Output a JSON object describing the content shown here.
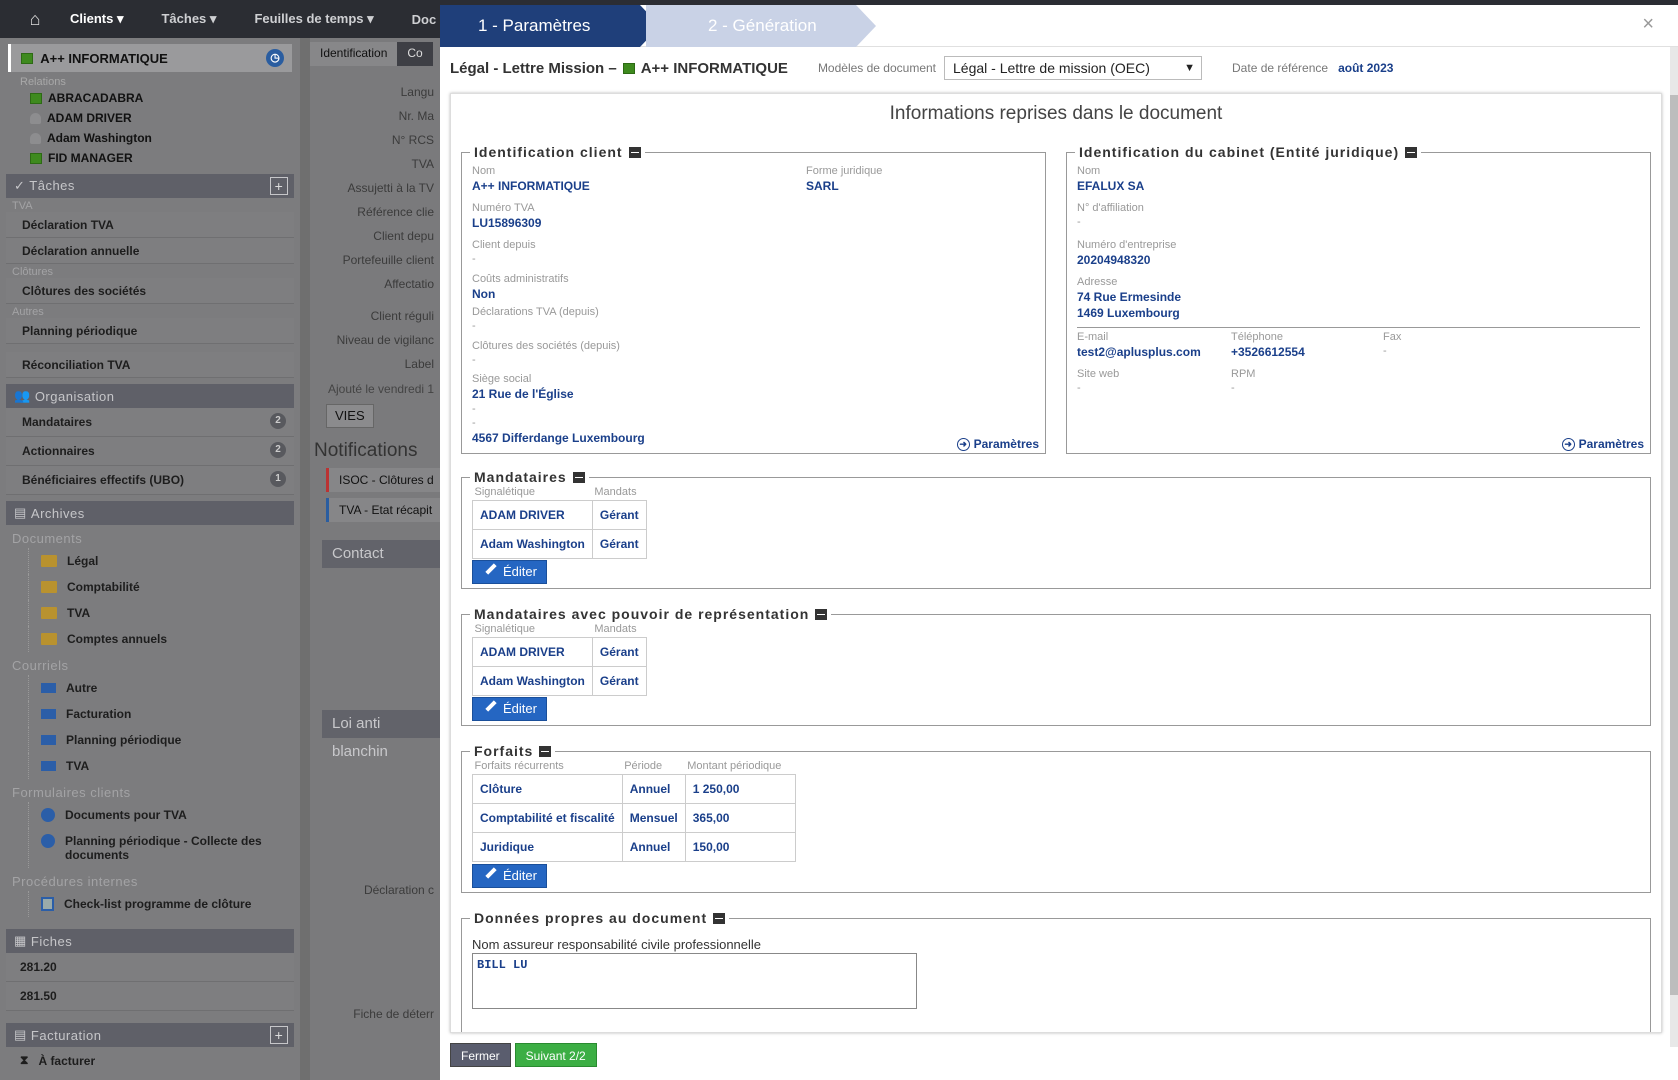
{
  "topnav": {
    "menus": [
      "Clients ▾",
      "Tâches ▾",
      "Feuilles de temps ▾",
      "Doc"
    ]
  },
  "sidebar": {
    "selected_client": "A++ INFORMATIQUE",
    "relations_label": "Relations",
    "relations": [
      "ABRACADABRA",
      "ADAM DRIVER",
      "Adam Washington",
      "FID MANAGER"
    ],
    "taches_head": "✓ Tâches",
    "tva_cat": "TVA",
    "tva_items": [
      "Déclaration TVA",
      "Déclaration annuelle"
    ],
    "clot_cat": "Clôtures",
    "clot_items": [
      "Clôtures des sociétés"
    ],
    "autres_cat": "Autres",
    "autres_items": [
      "Planning périodique"
    ],
    "recon": "Réconciliation TVA",
    "org_head": "Organisation",
    "org_items": [
      {
        "label": "Mandataires",
        "count": "2"
      },
      {
        "label": "Actionnaires",
        "count": "2"
      },
      {
        "label": "Bénéficiaires effectifs (UBO)",
        "count": "1"
      }
    ],
    "archives_head": "Archives",
    "documents_group": "Documents",
    "documents": [
      "Légal",
      "Comptabilité",
      "TVA",
      "Comptes annuels"
    ],
    "courriels_group": "Courriels",
    "courriels": [
      "Autre",
      "Facturation",
      "Planning périodique",
      "TVA"
    ],
    "formulaires_group": "Formulaires clients",
    "formulaires": [
      "Documents pour TVA",
      "Planning périodique - Collecte des documents"
    ],
    "procedures_group": "Procédures internes",
    "procedures": [
      "Check-list programme de clôture"
    ],
    "fiches_head": "Fiches",
    "fiches": [
      "281.20",
      "281.50"
    ],
    "facturation_head": "Facturation",
    "facturation_items": [
      "À facturer"
    ]
  },
  "mid": {
    "tabs": [
      "Identification",
      "Co"
    ],
    "labels": [
      "Langu",
      "Nr. Ma",
      "N° RCS",
      "TVA",
      "Assujetti à la TV",
      "Référence clie",
      "Client depu",
      "Portefeuille client",
      "Affectatio",
      "Client réguli",
      "Niveau de vigilanc",
      "Label"
    ],
    "added": "Ajouté le vendredi 1",
    "vies": "VIES",
    "notifications": "Notifications",
    "notif1": "ISOC - Clôtures d",
    "notif2": "TVA - Etat récapit",
    "contact": "Contact",
    "loi": "Loi anti blanchin",
    "decl": "Déclaration c",
    "fiche": "Fiche de déterr"
  },
  "wizard": {
    "step1": "1 - Paramètres",
    "step2": "2 - Génération",
    "close": "×"
  },
  "header": {
    "title": "Légal - Lettre Mission –",
    "client": "A++ INFORMATIQUE",
    "model_label": "Modèles de document",
    "model_value": "Légal - Lettre de mission (OEC)",
    "date_label": "Date de référence",
    "date_value": "août 2023"
  },
  "content": {
    "title": "Informations reprises dans le document",
    "client": {
      "legend": "Identification client",
      "nom_label": "Nom",
      "nom": "A++ INFORMATIQUE",
      "forme_label": "Forme juridique",
      "forme": "SARL",
      "tva_label": "Numéro TVA",
      "tva": "LU15896309",
      "depuis_label": "Client depuis",
      "depuis": "-",
      "couts_label": "Coûts administratifs",
      "couts": "Non",
      "decl_label": "Déclarations TVA (depuis)",
      "decl": "-",
      "clot_label": "Clôtures des sociétés (depuis)",
      "clot": "-",
      "siege_label": "Siège social",
      "siege1": "21 Rue de l'Église",
      "siege2": "-",
      "siege3": "-",
      "ville": "4567 Differdange Luxembourg",
      "link": "Paramètres"
    },
    "cabinet": {
      "legend": "Identification du cabinet (Entité juridique)",
      "nom_label": "Nom",
      "nom": "EFALUX SA",
      "aff_label": "N° d'affiliation",
      "aff": "-",
      "ent_label": "Numéro d'entreprise",
      "ent": "20204948320",
      "addr_label": "Adresse",
      "addr1": "74 Rue Ermesinde",
      "addr2": "1469 Luxembourg",
      "email_label": "E-mail",
      "email": "test2@aplusplus.com",
      "tel_label": "Téléphone",
      "tel": "+3526612554",
      "fax_label": "Fax",
      "fax": "-",
      "web_label": "Site web",
      "web": "-",
      "rpm_label": "RPM",
      "rpm": "-",
      "link": "Paramètres"
    },
    "mandataires": {
      "legend": "Mandataires",
      "headers": [
        "Signalétique",
        "Mandats"
      ],
      "rows": [
        [
          "ADAM DRIVER",
          "Gérant"
        ],
        [
          "Adam Washington",
          "Gérant"
        ]
      ],
      "edit": "Éditer"
    },
    "mandataires_pouvoir": {
      "legend": "Mandataires avec pouvoir de représentation",
      "headers": [
        "Signalétique",
        "Mandats"
      ],
      "rows": [
        [
          "ADAM DRIVER",
          "Gérant"
        ],
        [
          "Adam Washington",
          "Gérant"
        ]
      ],
      "edit": "Éditer"
    },
    "forfaits": {
      "legend": "Forfaits",
      "headers": [
        "Forfaits récurrents",
        "Période",
        "Montant périodique"
      ],
      "rows": [
        [
          "Clôture",
          "Annuel",
          "1 250,00"
        ],
        [
          "Comptabilité et fiscalité",
          "Mensuel",
          "365,00"
        ],
        [
          "Juridique",
          "Annuel",
          "150,00"
        ]
      ],
      "edit": "Éditer"
    },
    "donnees": {
      "legend": "Données propres au document",
      "field_label": "Nom assureur responsabilité civile professionnelle",
      "field_value": "BILL LU"
    }
  },
  "footer": {
    "close": "Fermer",
    "next": "Suivant 2/2"
  }
}
